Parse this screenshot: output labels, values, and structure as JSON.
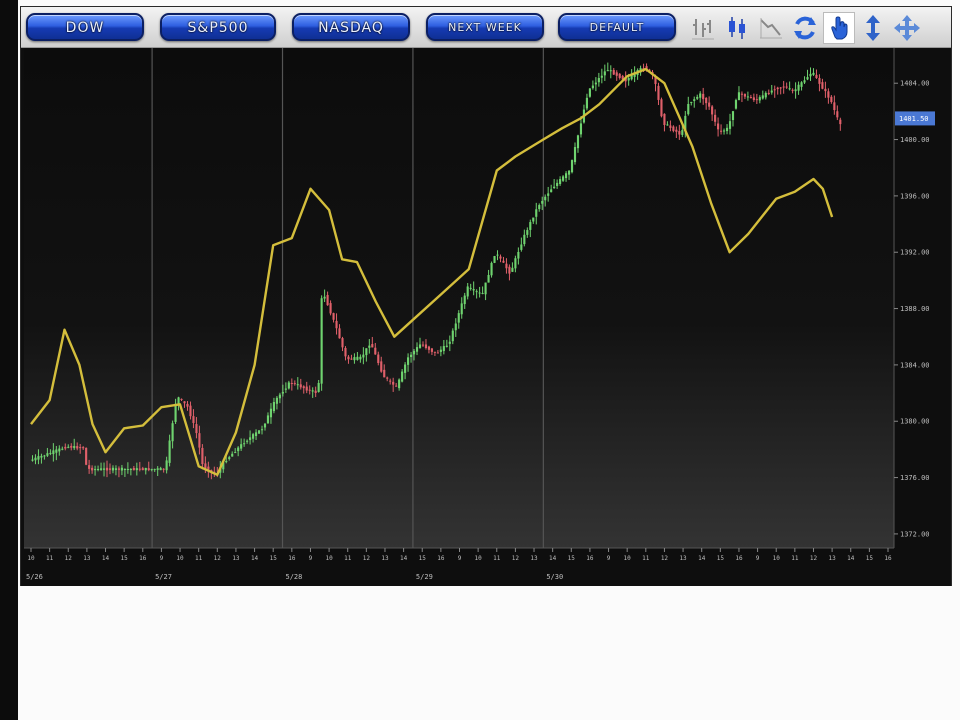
{
  "toolbar": {
    "buttons": [
      "DOW",
      "S&P500",
      "NASDAQ",
      "NEXT WEEK",
      "DEFAULT"
    ],
    "tools": [
      "bar-chart-icon",
      "candlestick-icon",
      "line-chart-icon",
      "refresh-icon",
      "hand-pan-icon",
      "vertical-resize-icon",
      "move-icon"
    ],
    "selected_tool": "hand-pan-icon"
  },
  "chart_data": {
    "type": "candlestick",
    "colors": {
      "up": "#6fd36f",
      "down": "#e0606a",
      "line": "#d4be3c",
      "background": "#111111",
      "last_price_box": "#4a78d4"
    },
    "price_axis": {
      "ticks": [
        "1404.00",
        "1400.00",
        "1396.00",
        "1392.00",
        "1388.00",
        "1384.00",
        "1380.00",
        "1376.00",
        "1372.00"
      ],
      "last_price": "1401.50"
    },
    "time_axis": {
      "ticks": [
        "10",
        "11",
        "12",
        "13",
        "14",
        "15",
        "16",
        "9",
        "10",
        "11",
        "12",
        "13",
        "14",
        "15",
        "16",
        "9",
        "10",
        "11",
        "12",
        "13",
        "14",
        "15",
        "16",
        "9",
        "10",
        "11",
        "12",
        "13",
        "14",
        "15",
        "16",
        "9",
        "10",
        "11",
        "12",
        "13",
        "14",
        "15",
        "16",
        "9",
        "10",
        "11",
        "12",
        "13",
        "14",
        "15",
        "16"
      ],
      "dates": [
        "5/26",
        "5/27",
        "5/28",
        "5/29",
        "5/30"
      ],
      "sessions": 5,
      "ticks_per_session": 7,
      "start_hour": 10
    },
    "ylim": [
      1371,
      1406.5
    ],
    "price_path": [
      [
        0,
        1377.2
      ],
      [
        2,
        1378.2
      ],
      [
        3,
        1378.1
      ],
      [
        3.05,
        1376.6
      ],
      [
        7.3,
        1376.6
      ],
      [
        7.4,
        1377.5
      ],
      [
        7.9,
        1381.8
      ],
      [
        8.5,
        1381.0
      ],
      [
        9,
        1379.0
      ],
      [
        9.3,
        1376.8
      ],
      [
        10,
        1376.2
      ],
      [
        10.5,
        1377.2
      ],
      [
        11.5,
        1378.5
      ],
      [
        12.5,
        1379.5
      ],
      [
        13.2,
        1381.5
      ],
      [
        14,
        1382.8
      ],
      [
        15,
        1382.2
      ],
      [
        15.5,
        1382.0
      ],
      [
        15.7,
        1389.4
      ],
      [
        16.5,
        1386.5
      ],
      [
        17,
        1384.4
      ],
      [
        17.8,
        1384.5
      ],
      [
        18.3,
        1385.6
      ],
      [
        19,
        1383.2
      ],
      [
        19.7,
        1382.4
      ],
      [
        20.3,
        1384.5
      ],
      [
        21,
        1385.5
      ],
      [
        21.8,
        1384.8
      ],
      [
        22.5,
        1385.5
      ],
      [
        23,
        1387.5
      ],
      [
        23.5,
        1389.5
      ],
      [
        24.3,
        1389.0
      ],
      [
        25,
        1392.0
      ],
      [
        25.8,
        1390.5
      ],
      [
        26.5,
        1393.0
      ],
      [
        27.3,
        1395.3
      ],
      [
        28,
        1396.5
      ],
      [
        29,
        1397.8
      ],
      [
        29.3,
        1399.5
      ],
      [
        30,
        1403.5
      ],
      [
        31,
        1405.0
      ],
      [
        32,
        1404.2
      ],
      [
        33,
        1405.2
      ],
      [
        33.5,
        1404.5
      ],
      [
        34,
        1401.2
      ],
      [
        35,
        1400.3
      ],
      [
        35.3,
        1402.5
      ],
      [
        36,
        1403.2
      ],
      [
        36.5,
        1402.3
      ],
      [
        37,
        1400.5
      ],
      [
        37.5,
        1400.8
      ],
      [
        38,
        1403.3
      ],
      [
        39,
        1402.8
      ],
      [
        40,
        1403.6
      ],
      [
        40.5,
        1403.8
      ],
      [
        41,
        1403.4
      ],
      [
        42,
        1404.8
      ],
      [
        43,
        1402.8
      ],
      [
        43.5,
        1401.0
      ]
    ],
    "indicator_path": [
      [
        0,
        1379.8
      ],
      [
        1,
        1381.5
      ],
      [
        1.8,
        1386.5
      ],
      [
        2.6,
        1384.0
      ],
      [
        3.3,
        1379.8
      ],
      [
        4,
        1377.8
      ],
      [
        5,
        1379.5
      ],
      [
        6,
        1379.7
      ],
      [
        7,
        1381.0
      ],
      [
        8,
        1381.2
      ],
      [
        9,
        1376.8
      ],
      [
        10,
        1376.2
      ],
      [
        11,
        1379.2
      ],
      [
        12,
        1384.0
      ],
      [
        13,
        1392.5
      ],
      [
        14,
        1393.0
      ],
      [
        15,
        1396.5
      ],
      [
        16,
        1395.0
      ],
      [
        16.7,
        1391.5
      ],
      [
        17.5,
        1391.3
      ],
      [
        18.5,
        1388.5
      ],
      [
        19.5,
        1386.0
      ],
      [
        20.5,
        1387.2
      ],
      [
        22,
        1389.0
      ],
      [
        23.5,
        1390.8
      ],
      [
        25,
        1397.8
      ],
      [
        26,
        1398.8
      ],
      [
        27.5,
        1400.0
      ],
      [
        28.5,
        1400.8
      ],
      [
        29.5,
        1401.5
      ],
      [
        30.5,
        1402.5
      ],
      [
        32,
        1404.5
      ],
      [
        33,
        1405.0
      ],
      [
        34,
        1404.0
      ],
      [
        35.5,
        1399.5
      ],
      [
        36.5,
        1395.5
      ],
      [
        37.5,
        1392.0
      ],
      [
        38.5,
        1393.3
      ],
      [
        40,
        1395.8
      ],
      [
        41,
        1396.3
      ],
      [
        42,
        1397.2
      ],
      [
        42.5,
        1396.5
      ],
      [
        43,
        1394.5
      ]
    ]
  }
}
